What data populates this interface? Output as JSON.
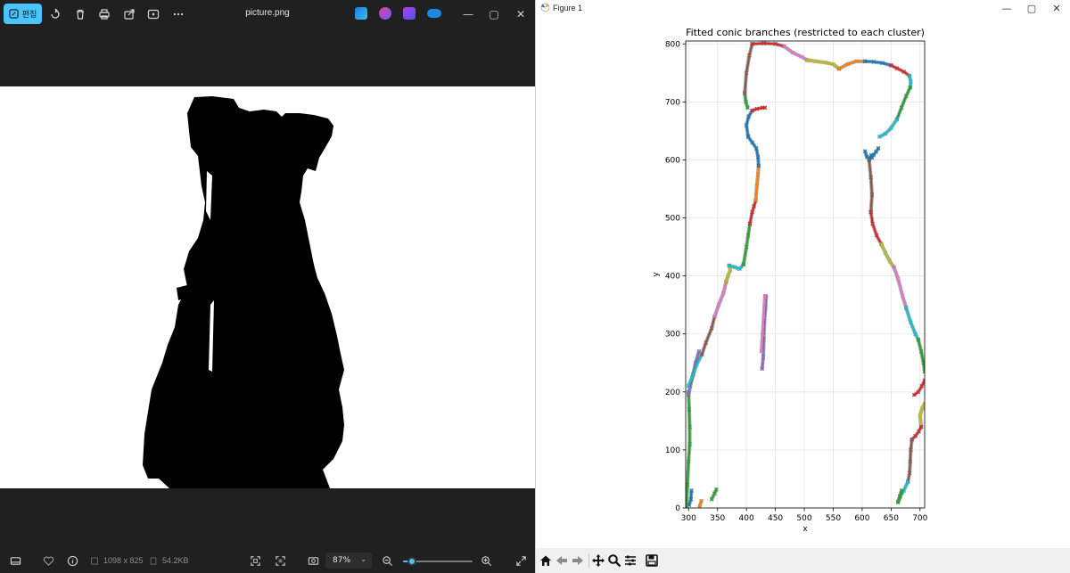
{
  "viewer": {
    "edit_label": "편집",
    "filename": "picture.png",
    "image_size": "1098 x 825",
    "file_size": "54.2KB",
    "zoom_value": "87%",
    "zoom_fraction": 0.13,
    "toolbar_icons": [
      "rotate-icon",
      "delete-icon",
      "print-icon",
      "share-icon",
      "slideshow-icon",
      "more-icon"
    ],
    "app_icons": [
      "designer-icon",
      "copilot-icon",
      "clipchamp-icon",
      "onedrive-icon"
    ],
    "accent": "#4cc2ff"
  },
  "figure": {
    "window_title": "Figure 1",
    "toolbar_buttons": [
      "home-icon",
      "back-icon",
      "forward-icon",
      "pan-icon",
      "zoom-icon",
      "configure-icon",
      "save-icon"
    ]
  },
  "chart_data": {
    "type": "line",
    "title": "Fitted conic branches (restricted to each cluster)",
    "xlabel": "x",
    "ylabel": "y",
    "xlim": [
      295,
      708
    ],
    "ylim": [
      0,
      805
    ],
    "xticks": [
      300,
      350,
      400,
      450,
      500,
      550,
      600,
      650,
      700
    ],
    "yticks": [
      0,
      100,
      200,
      300,
      400,
      500,
      600,
      700,
      800
    ],
    "grid": true,
    "series": [
      {
        "color": "#1f77b4",
        "x": [
          301,
          304,
          305
        ],
        "y": [
          5,
          15,
          30
        ]
      },
      {
        "color": "#2ca02c",
        "x": [
          296,
          298,
          300,
          302,
          302,
          301,
          300
        ],
        "y": [
          0,
          40,
          80,
          110,
          140,
          170,
          200
        ]
      },
      {
        "color": "#9467bd",
        "x": [
          300,
          303,
          308,
          312,
          318
        ],
        "y": [
          195,
          210,
          230,
          250,
          270
        ]
      },
      {
        "color": "#17becf",
        "x": [
          300,
          306,
          314,
          323
        ],
        "y": [
          210,
          225,
          247,
          265
        ]
      },
      {
        "color": "#8c564b",
        "x": [
          323,
          330,
          340,
          345
        ],
        "y": [
          265,
          285,
          310,
          330
        ]
      },
      {
        "color": "#e377c2",
        "x": [
          345,
          352,
          360,
          365
        ],
        "y": [
          330,
          350,
          370,
          390
        ]
      },
      {
        "color": "#bcbd22",
        "x": [
          365,
          368,
          372,
          370
        ],
        "y": [
          390,
          400,
          410,
          418
        ]
      },
      {
        "color": "#17becf",
        "x": [
          370,
          380,
          388,
          395
        ],
        "y": [
          418,
          415,
          412,
          420
        ]
      },
      {
        "color": "#2ca02c",
        "x": [
          395,
          400,
          403,
          406
        ],
        "y": [
          420,
          450,
          470,
          490
        ]
      },
      {
        "color": "#d62728",
        "x": [
          406,
          410,
          413,
          416
        ],
        "y": [
          490,
          510,
          520,
          530
        ]
      },
      {
        "color": "#ff7f0e",
        "x": [
          416,
          418,
          420,
          421
        ],
        "y": [
          530,
          555,
          575,
          590
        ]
      },
      {
        "color": "#1f77b4",
        "x": [
          421,
          420,
          417,
          410,
          403
        ],
        "y": [
          590,
          605,
          620,
          630,
          640
        ]
      },
      {
        "color": "#1f77b4",
        "x": [
          403,
          400,
          404,
          410
        ],
        "y": [
          640,
          660,
          675,
          685
        ]
      },
      {
        "color": "#d62728",
        "x": [
          410,
          418,
          428,
          432
        ],
        "y": [
          685,
          688,
          690,
          690
        ]
      },
      {
        "color": "#2ca02c",
        "x": [
          402,
          399,
          397
        ],
        "y": [
          690,
          700,
          715
        ]
      },
      {
        "color": "#8c564b",
        "x": [
          397,
          400,
          405,
          410
        ],
        "y": [
          715,
          750,
          780,
          800
        ]
      },
      {
        "color": "#d62728",
        "x": [
          410,
          430,
          450,
          465
        ],
        "y": [
          800,
          801,
          800,
          796
        ]
      },
      {
        "color": "#e377c2",
        "x": [
          465,
          480,
          495,
          505
        ],
        "y": [
          796,
          785,
          778,
          772
        ]
      },
      {
        "color": "#bcbd22",
        "x": [
          505,
          520,
          535,
          550,
          560
        ],
        "y": [
          772,
          770,
          768,
          765,
          757
        ]
      },
      {
        "color": "#ff7f0e",
        "x": [
          560,
          575,
          590,
          605
        ],
        "y": [
          757,
          765,
          770,
          770
        ]
      },
      {
        "color": "#1f77b4",
        "x": [
          605,
          620,
          635,
          650
        ],
        "y": [
          770,
          769,
          767,
          763
        ]
      },
      {
        "color": "#d62728",
        "x": [
          650,
          660,
          672,
          682
        ],
        "y": [
          763,
          758,
          752,
          745
        ]
      },
      {
        "color": "#17becf",
        "x": [
          682,
          684,
          683
        ],
        "y": [
          745,
          735,
          725
        ]
      },
      {
        "color": "#2ca02c",
        "x": [
          683,
          676,
          668,
          660
        ],
        "y": [
          725,
          710,
          690,
          670
        ]
      },
      {
        "color": "#17becf",
        "x": [
          660,
          650,
          640,
          630
        ],
        "y": [
          670,
          655,
          645,
          640
        ]
      },
      {
        "color": "#1f77b4",
        "x": [
          628,
          624,
          620,
          617,
          612
        ],
        "y": [
          620,
          614,
          609,
          604,
          600
        ]
      },
      {
        "color": "#8c564b",
        "x": [
          612,
          615,
          617,
          615
        ],
        "y": [
          600,
          570,
          540,
          510
        ]
      },
      {
        "color": "#d62728",
        "x": [
          615,
          618,
          625,
          633
        ],
        "y": [
          510,
          490,
          470,
          455
        ]
      },
      {
        "color": "#bcbd22",
        "x": [
          633,
          640,
          648,
          655
        ],
        "y": [
          455,
          440,
          425,
          415
        ]
      },
      {
        "color": "#e377c2",
        "x": [
          655,
          662,
          670,
          676
        ],
        "y": [
          415,
          395,
          365,
          345
        ]
      },
      {
        "color": "#17becf",
        "x": [
          676,
          684,
          692,
          697
        ],
        "y": [
          345,
          320,
          300,
          290
        ]
      },
      {
        "color": "#2ca02c",
        "x": [
          697,
          702,
          706,
          708
        ],
        "y": [
          290,
          270,
          250,
          235
        ]
      },
      {
        "color": "#d62728",
        "x": [
          708,
          703,
          697,
          690
        ],
        "y": [
          220,
          210,
          200,
          195
        ]
      },
      {
        "color": "#bcbd22",
        "x": [
          708,
          704,
          700,
          702
        ],
        "y": [
          180,
          172,
          160,
          140
        ]
      },
      {
        "color": "#d62728",
        "x": [
          702,
          698,
          692,
          686
        ],
        "y": [
          140,
          132,
          124,
          118
        ]
      },
      {
        "color": "#8c564b",
        "x": [
          686,
          684,
          683,
          682,
          679
        ],
        "y": [
          118,
          100,
          80,
          60,
          45
        ]
      },
      {
        "color": "#17becf",
        "x": [
          679,
          672,
          666,
          662
        ],
        "y": [
          45,
          30,
          20,
          10
        ]
      },
      {
        "color": "#2ca02c",
        "x": [
          662,
          665,
          668
        ],
        "y": [
          10,
          20,
          30
        ]
      },
      {
        "color": "#9467bd",
        "x": [
          427,
          429,
          430,
          431,
          433,
          434
        ],
        "y": [
          240,
          260,
          290,
          320,
          345,
          365
        ]
      },
      {
        "color": "#e377c2",
        "x": [
          432,
          430,
          428,
          426
        ],
        "y": [
          365,
          330,
          300,
          270
        ]
      },
      {
        "color": "#2ca02c",
        "x": [
          340,
          345,
          348
        ],
        "y": [
          15,
          25,
          32
        ]
      },
      {
        "color": "#1f77b4",
        "x": [
          605,
          608,
          612,
          616
        ],
        "y": [
          615,
          605,
          603,
          608
        ]
      },
      {
        "color": "#ff7f0e",
        "x": [
          319,
          322
        ],
        "y": [
          2,
          12
        ]
      }
    ]
  }
}
